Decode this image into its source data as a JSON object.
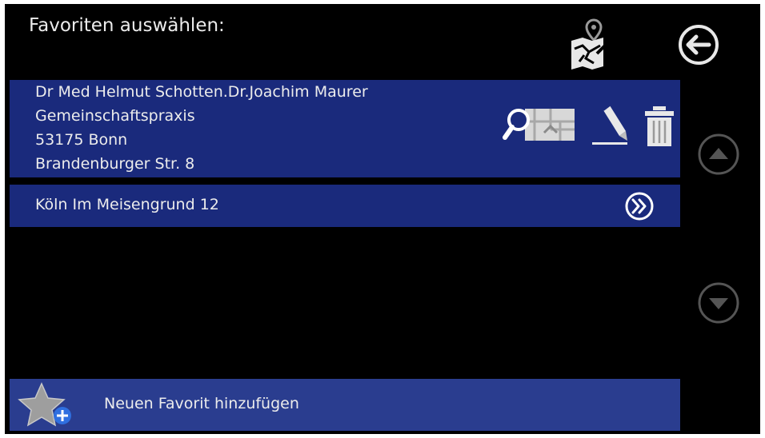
{
  "header": {
    "title": "Favoriten auswählen:",
    "map_edit_icon": "map-pin-edit-icon",
    "back_icon": "back-arrow-icon"
  },
  "favorites": [
    {
      "lines": [
        "Dr Med Helmut Schotten.Dr.Joachim Maurer",
        "Gemeinschaftspraxis",
        "53175 Bonn",
        "Brandenburger Str. 8"
      ],
      "expanded": true,
      "actions": [
        "map-search-icon",
        "pencil-icon",
        "trash-icon"
      ]
    },
    {
      "label": "Köln Im Meisengrund 12",
      "expanded": false,
      "action": "double-chevron-right-icon"
    }
  ],
  "scroll": {
    "up_icon": "scroll-up-icon",
    "down_icon": "scroll-down-icon"
  },
  "footer": {
    "add_label": "Neuen Favorit hinzufügen",
    "icon": "star-plus-icon"
  },
  "colors": {
    "background": "#000000",
    "row": "#1a2a7c",
    "add_bar": "#2a3d8f",
    "text": "#ececec",
    "icon": "#e8e8e8",
    "disabled": "#555555",
    "plus_badge": "#2f6fe0"
  }
}
